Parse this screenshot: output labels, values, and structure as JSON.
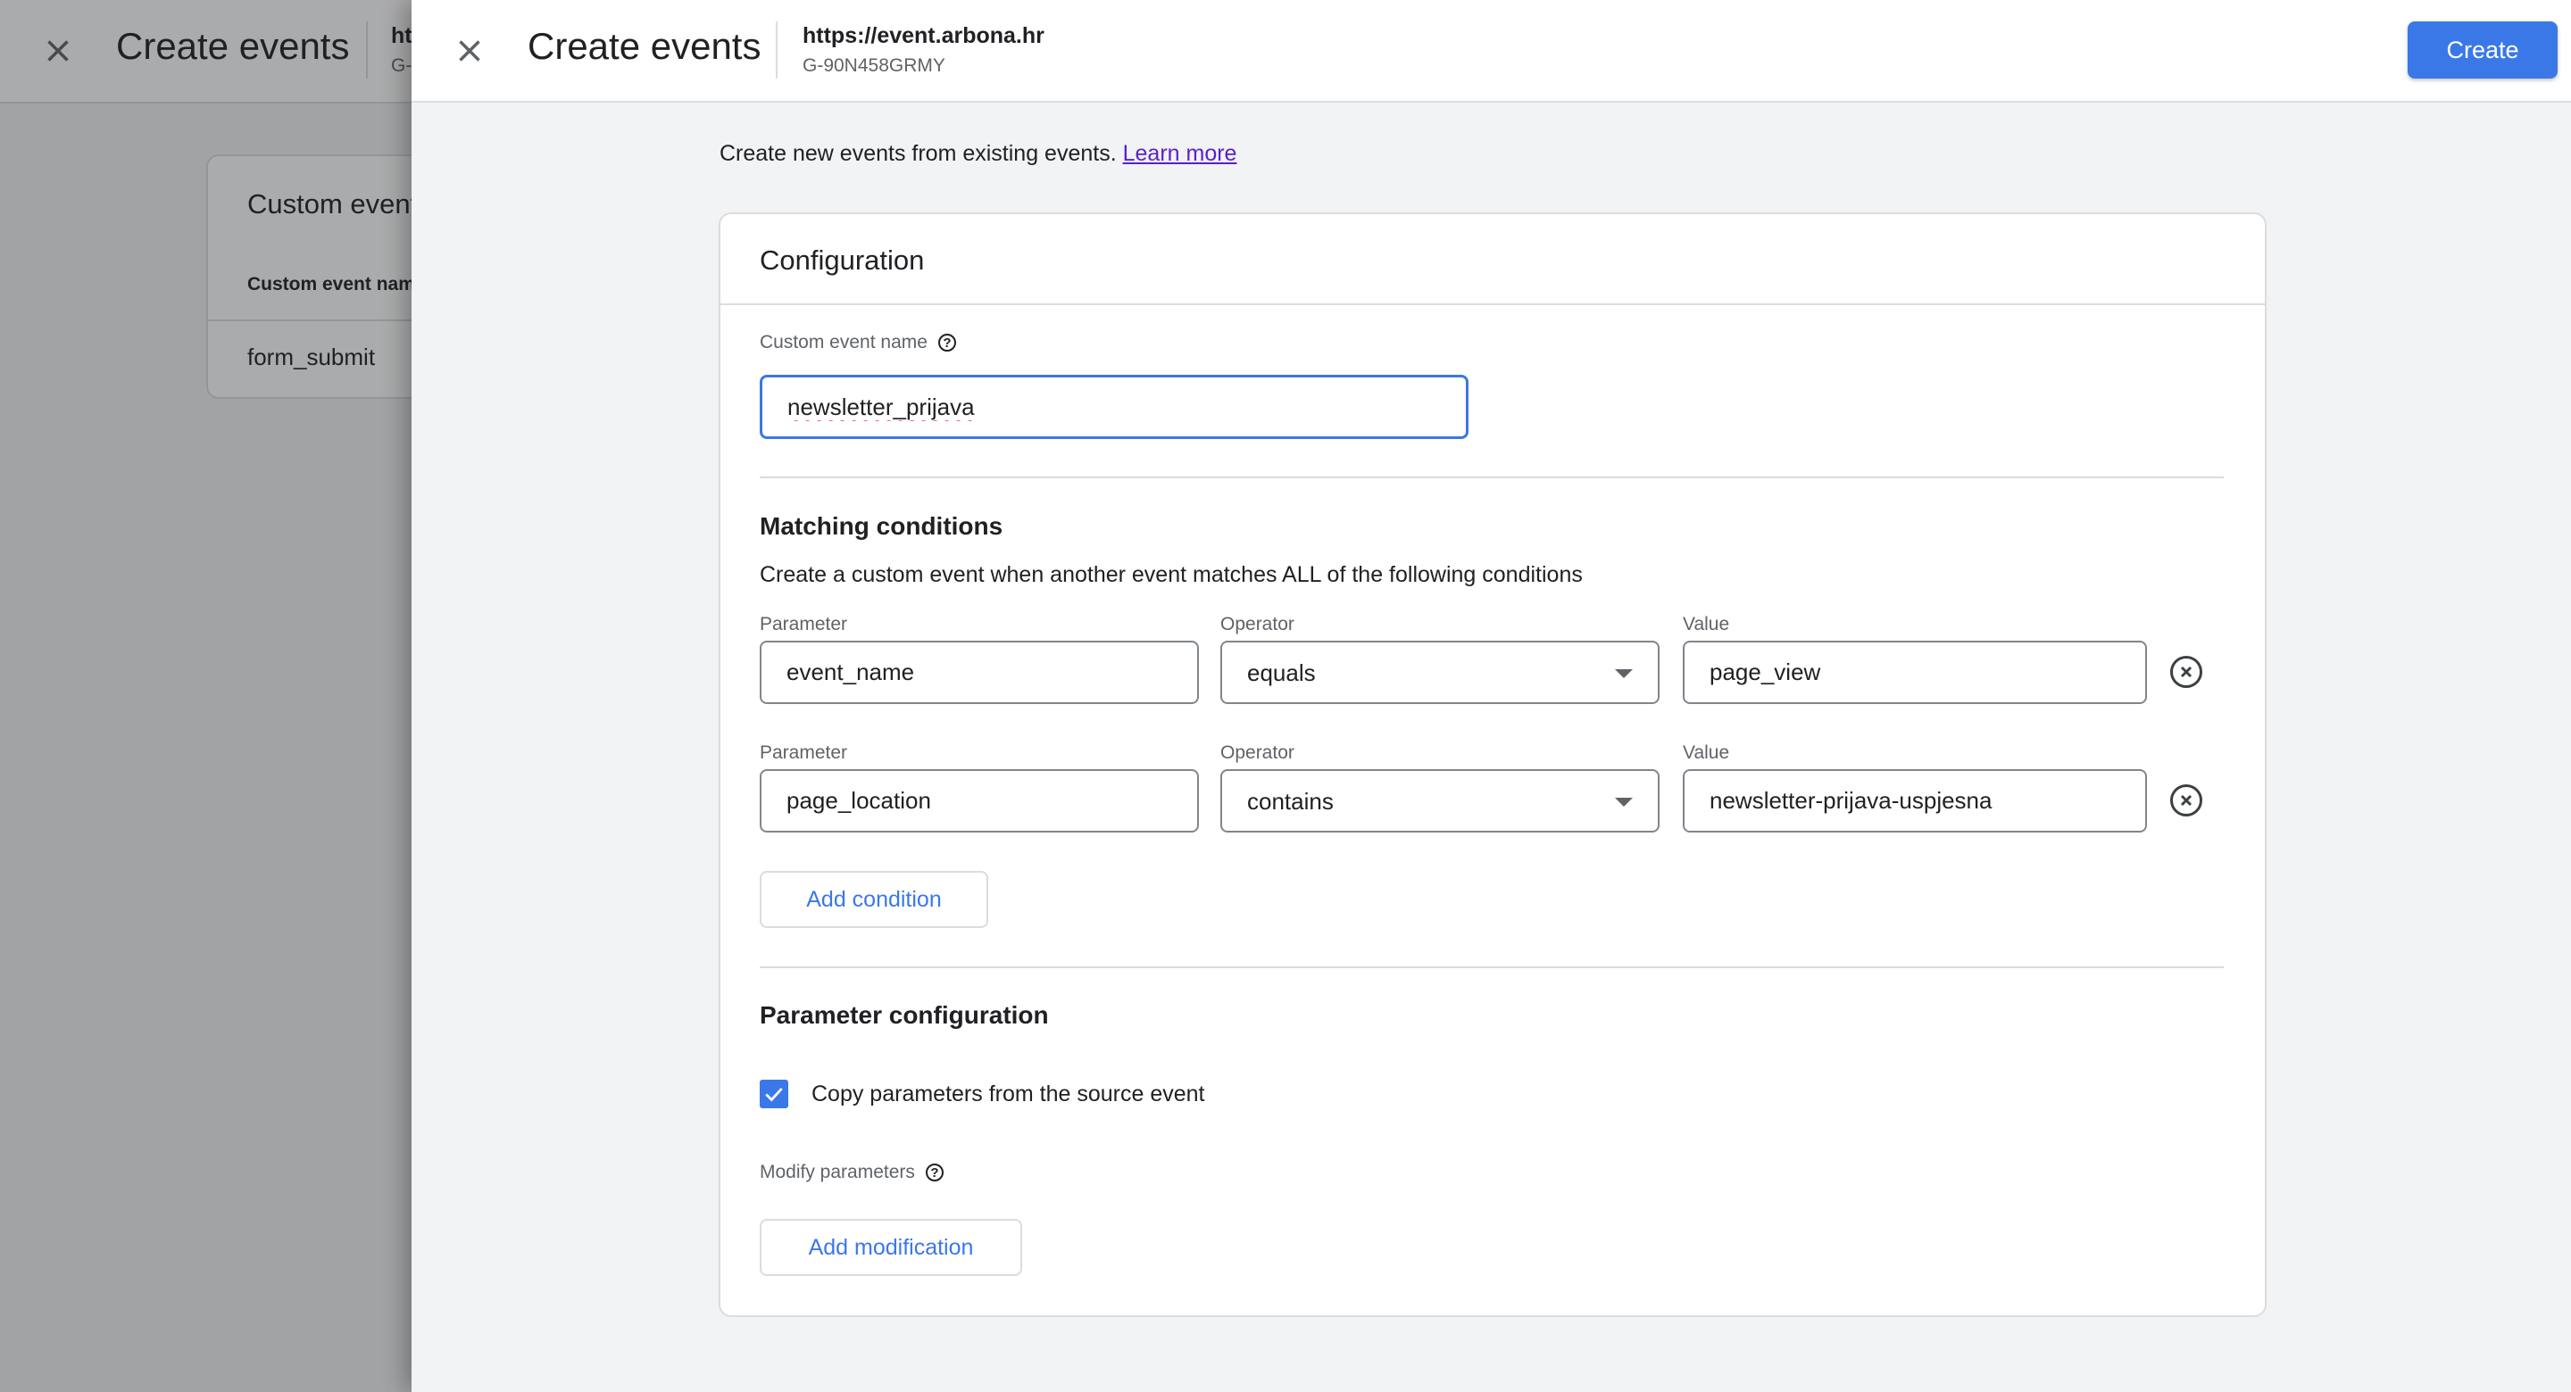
{
  "background_page": {
    "title": "Create events",
    "url_partial": "ht",
    "property_partial": "G-",
    "card": {
      "title": "Custom events",
      "column_header": "Custom event name",
      "rows": [
        "form_submit"
      ]
    }
  },
  "panel": {
    "title": "Create events",
    "site_url": "https://event.arbona.hr",
    "property_id": "G-90N458GRMY",
    "create_label": "Create",
    "intro_text": "Create new events from existing events.",
    "learn_more": "Learn more",
    "configuration": {
      "title": "Configuration",
      "custom_event_name_label": "Custom event name",
      "custom_event_name_value": "newsletter_prijava",
      "matching": {
        "title": "Matching conditions",
        "description": "Create a custom event when another event matches ALL of the following conditions",
        "conditions": [
          {
            "parameter_label": "Parameter",
            "parameter": "event_name",
            "operator_label": "Operator",
            "operator": "equals",
            "value_label": "Value",
            "value": "page_view"
          },
          {
            "parameter_label": "Parameter",
            "parameter": "page_location",
            "operator_label": "Operator",
            "operator": "contains",
            "value_label": "Value",
            "value": "newsletter-prijava-uspjesna"
          }
        ],
        "add_condition_label": "Add condition"
      },
      "parameter_configuration": {
        "title": "Parameter configuration",
        "copy_params_label": "Copy parameters from the source event",
        "copy_params_checked": true,
        "modify_label": "Modify parameters",
        "add_modification_label": "Add modification"
      }
    }
  },
  "colors": {
    "accent": "#3b78e7",
    "link": "#5b1fcc"
  },
  "icons": {
    "close": "close-icon",
    "help": "help-circle-icon",
    "remove": "remove-circle-icon",
    "dropdown": "caret-down-icon",
    "check": "check-icon"
  }
}
